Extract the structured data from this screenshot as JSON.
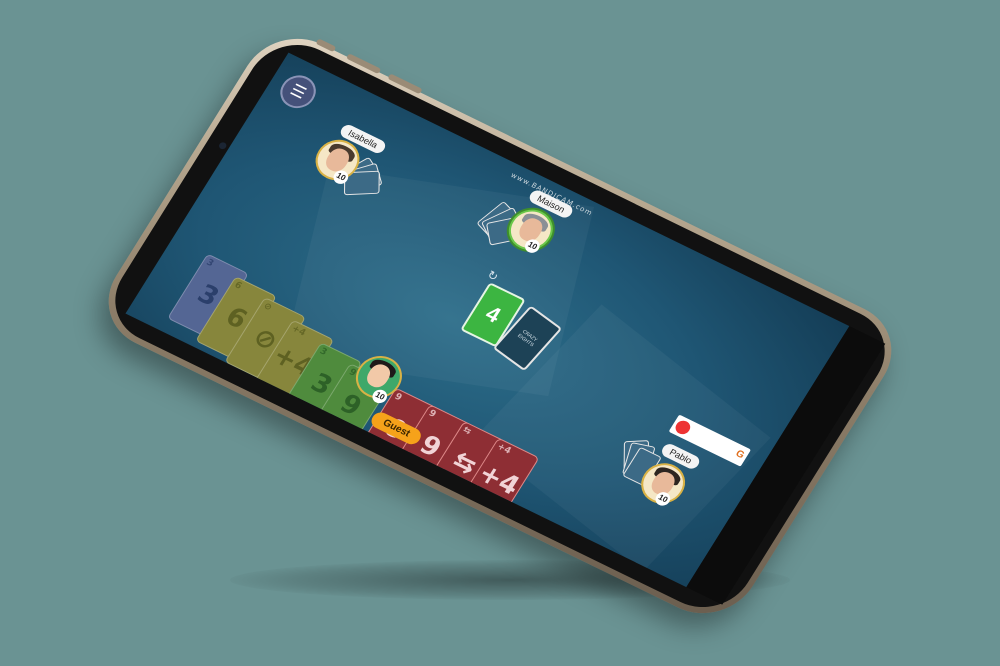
{
  "watermark": "www.BANDICAM.com",
  "menu": {
    "icon": "list-menu-icon",
    "glyph": "☰"
  },
  "opponents": [
    {
      "name": "Isabella",
      "cards": "10"
    },
    {
      "name": "Maison",
      "cards": "10"
    },
    {
      "name": "Pablo",
      "cards": "10"
    }
  ],
  "table": {
    "discard_top": "4",
    "draw_pile_label": "CRAZY EIGHTS",
    "rotate_icons": [
      "↻",
      "↺"
    ]
  },
  "player": {
    "name": "Guest",
    "cards": "10",
    "hand": [
      {
        "value": "3",
        "color": "blue"
      },
      {
        "value": "6",
        "color": "yellow"
      },
      {
        "value": "⊘",
        "color": "yellow"
      },
      {
        "value": "+4",
        "color": "yellow"
      },
      {
        "value": "3",
        "color": "green"
      },
      {
        "value": "9",
        "color": "green"
      },
      {
        "value": "9",
        "color": "red"
      },
      {
        "value": "9",
        "color": "red"
      },
      {
        "value": "⇆",
        "color": "red"
      },
      {
        "value": "+4",
        "color": "red"
      }
    ]
  },
  "colors": {
    "background": "#6a9393",
    "table_felt": "#1f5674",
    "active_turn_ring": "#6bc84a",
    "guest_button": "#f6a21a"
  }
}
